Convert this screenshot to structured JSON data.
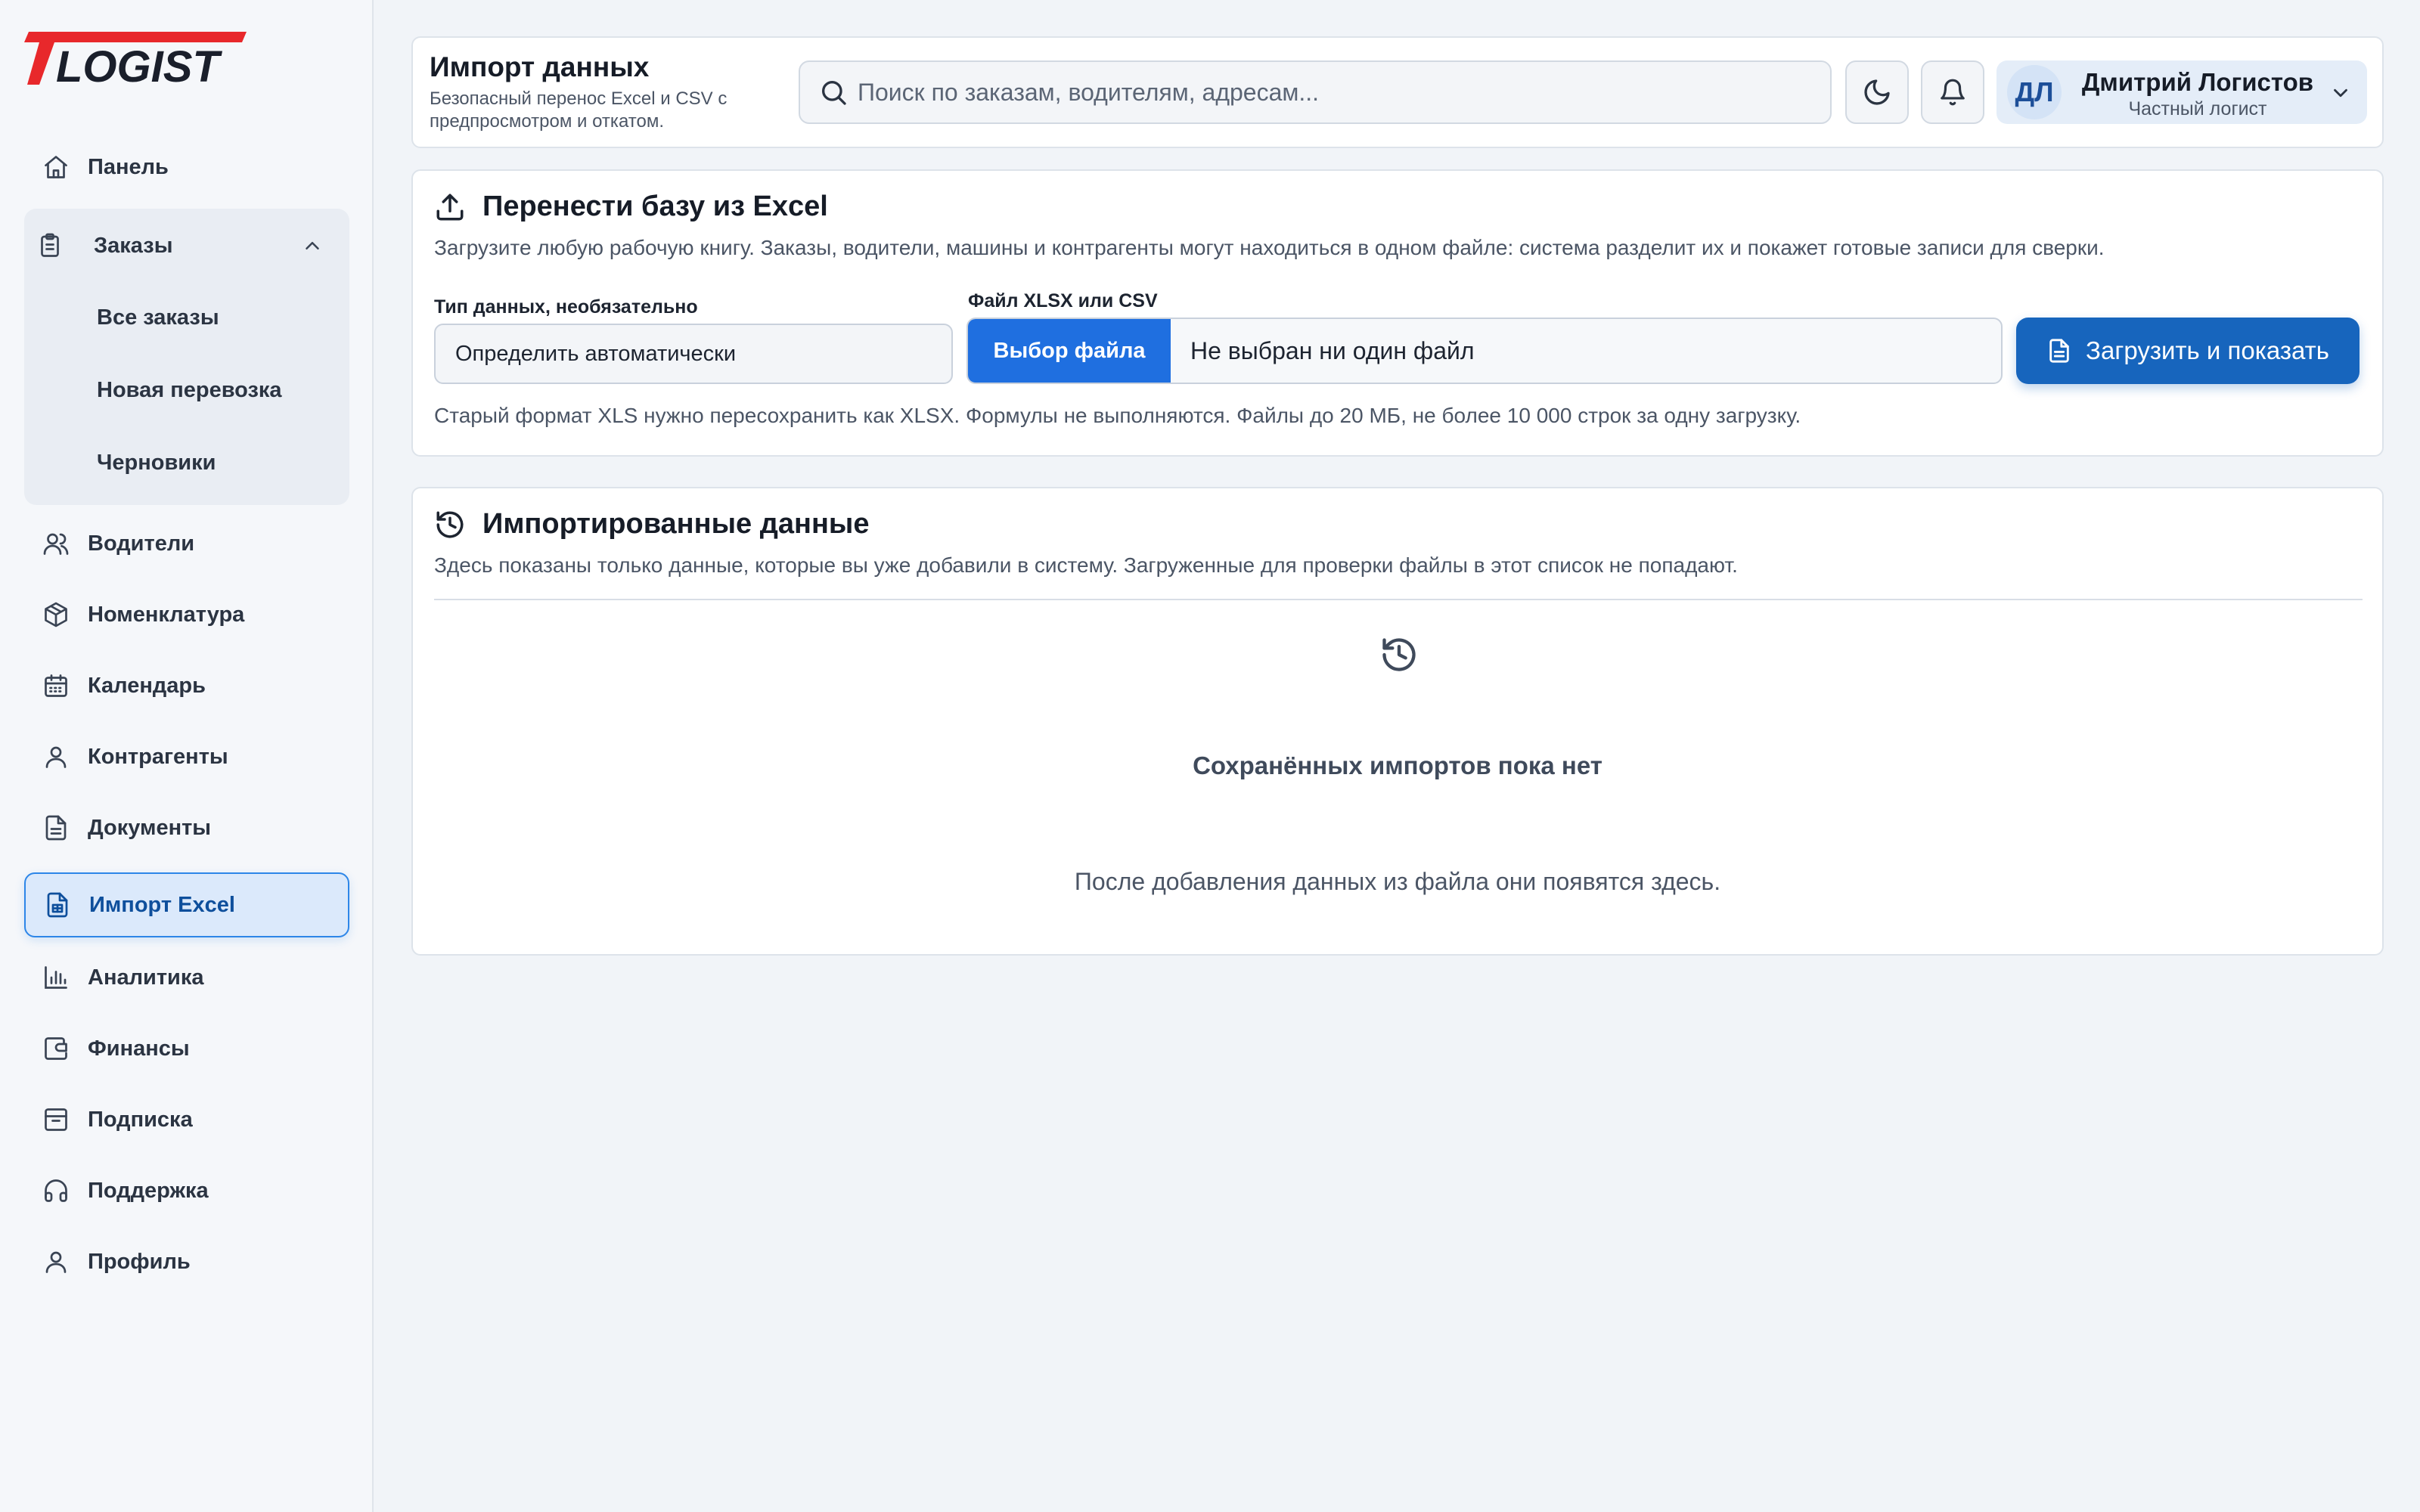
{
  "brand": {
    "logo_text": "LOGIST",
    "accent": "#e8282b"
  },
  "sidebar": {
    "items": [
      {
        "label": "Панель",
        "icon": "home-icon"
      },
      {
        "label": "Заказы",
        "icon": "clipboard-icon",
        "expanded": true,
        "children": [
          {
            "label": "Все заказы"
          },
          {
            "label": "Новая перевозка"
          },
          {
            "label": "Черновики"
          }
        ]
      },
      {
        "label": "Водители",
        "icon": "users-icon"
      },
      {
        "label": "Номенклатура",
        "icon": "package-icon"
      },
      {
        "label": "Календарь",
        "icon": "calendar-icon"
      },
      {
        "label": "Контрагенты",
        "icon": "user-icon"
      },
      {
        "label": "Документы",
        "icon": "document-icon"
      },
      {
        "label": "Импорт Excel",
        "icon": "spreadsheet-icon",
        "active": true
      },
      {
        "label": "Аналитика",
        "icon": "bar-chart-icon"
      },
      {
        "label": "Финансы",
        "icon": "wallet-icon"
      },
      {
        "label": "Подписка",
        "icon": "archive-icon"
      },
      {
        "label": "Поддержка",
        "icon": "headphones-icon"
      },
      {
        "label": "Профиль",
        "icon": "user-icon"
      }
    ]
  },
  "header": {
    "title": "Импорт данных",
    "subtitle": "Безопасный перенос Excel и CSV с предпросмотром и откатом.",
    "search_placeholder": "Поиск по заказам, водителям, адресам...",
    "user": {
      "initials": "ДЛ",
      "name": "Дмитрий Логистов",
      "role": "Частный логист"
    }
  },
  "import_card": {
    "title": "Перенести базу из Excel",
    "description": "Загрузите любую рабочую книгу. Заказы, водители, машины и контрагенты могут находиться в одном файле: система разделит их и покажет готовые записи для сверки.",
    "type_label": "Тип данных, необязательно",
    "type_value": "Определить автоматически",
    "file_label": "Файл XLSX или CSV",
    "file_button": "Выбор файла",
    "file_status": "Не выбран ни один файл",
    "submit_label": "Загрузить и показать",
    "hint": "Старый формат XLS нужно пересохранить как XLSX. Формулы не выполняются. Файлы до 20 МБ, не более 10 000 строк за одну загрузку."
  },
  "imported_card": {
    "title": "Импортированные данные",
    "description": "Здесь показаны только данные, которые вы уже добавили в систему. Загруженные для проверки файлы в этот список не попадают.",
    "empty_title": "Сохранённых импортов пока нет",
    "empty_text": "После добавления данных из файла они появятся здесь."
  }
}
